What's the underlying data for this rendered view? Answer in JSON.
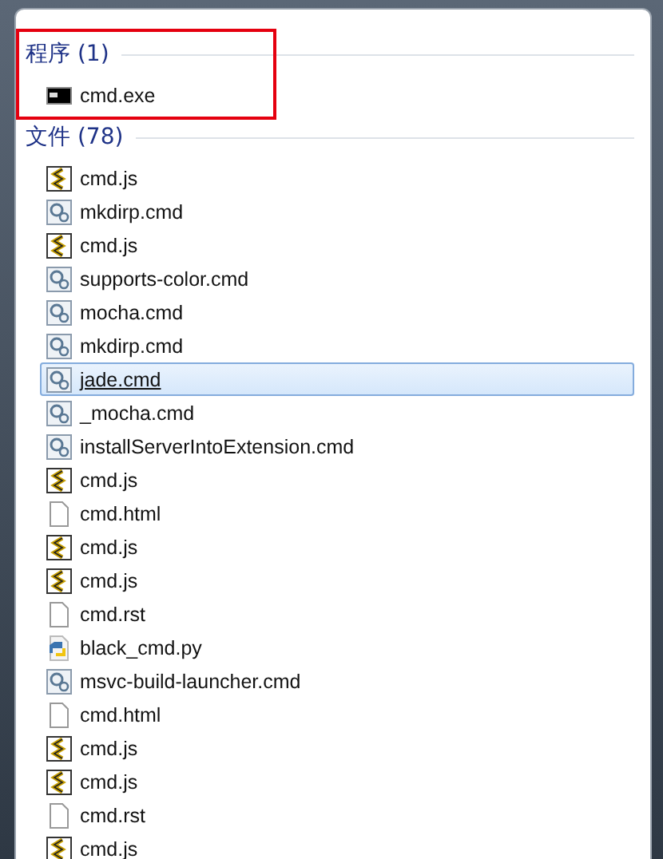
{
  "groups": [
    {
      "title": "程序 (1)",
      "highlighted": true,
      "items": [
        {
          "name": "cmd.exe",
          "kind": "exe",
          "selected": false
        }
      ]
    },
    {
      "title": "文件 (78)",
      "highlighted": false,
      "items": [
        {
          "name": "cmd.js",
          "kind": "js",
          "selected": false
        },
        {
          "name": "mkdirp.cmd",
          "kind": "cmd",
          "selected": false
        },
        {
          "name": "cmd.js",
          "kind": "js",
          "selected": false
        },
        {
          "name": "supports-color.cmd",
          "kind": "cmd",
          "selected": false
        },
        {
          "name": "mocha.cmd",
          "kind": "cmd",
          "selected": false
        },
        {
          "name": "mkdirp.cmd",
          "kind": "cmd",
          "selected": false
        },
        {
          "name": "jade.cmd",
          "kind": "cmd",
          "selected": true
        },
        {
          "name": "_mocha.cmd",
          "kind": "cmd",
          "selected": false
        },
        {
          "name": "installServerIntoExtension.cmd",
          "kind": "cmd",
          "selected": false
        },
        {
          "name": "cmd.js",
          "kind": "js",
          "selected": false
        },
        {
          "name": "cmd.html",
          "kind": "doc",
          "selected": false
        },
        {
          "name": "cmd.js",
          "kind": "js",
          "selected": false
        },
        {
          "name": "cmd.js",
          "kind": "js",
          "selected": false
        },
        {
          "name": "cmd.rst",
          "kind": "doc",
          "selected": false
        },
        {
          "name": "black_cmd.py",
          "kind": "py",
          "selected": false
        },
        {
          "name": "msvc-build-launcher.cmd",
          "kind": "cmd",
          "selected": false
        },
        {
          "name": "cmd.html",
          "kind": "doc",
          "selected": false
        },
        {
          "name": "cmd.js",
          "kind": "js",
          "selected": false
        },
        {
          "name": "cmd.js",
          "kind": "js",
          "selected": false
        },
        {
          "name": "cmd.rst",
          "kind": "doc",
          "selected": false
        },
        {
          "name": "cmd.js",
          "kind": "js",
          "selected": false
        }
      ]
    }
  ]
}
